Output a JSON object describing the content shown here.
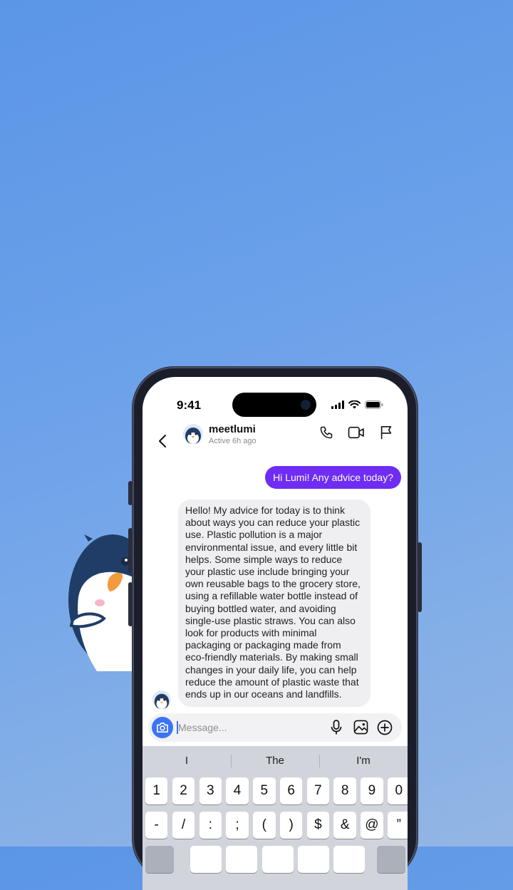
{
  "status_bar": {
    "time": "9:41"
  },
  "header": {
    "contact_name": "meetlumi",
    "active_status": "Active 6h ago",
    "icons": [
      "back-chevron-icon",
      "phone-icon",
      "video-icon",
      "flag-icon"
    ]
  },
  "messages": {
    "outgoing": "Hi Lumi! Any advice today?",
    "incoming": "Hello! My advice for today is to think about ways you can reduce your plastic use. Plastic pollution is a major environmental issue, and every little bit helps. Some simple ways to reduce your plastic use include bringing your own reusable bags to the grocery store, using a refillable water bottle instead of buying bottled water, and avoiding single-use plastic straws. You can also look for products with minimal packaging or packaging made from eco-friendly materials. By making small changes in your daily life, you can help reduce the amount of plastic waste that ends up in our oceans and landfills."
  },
  "composer": {
    "placeholder": "Message...",
    "icons": [
      "camera-icon",
      "microphone-icon",
      "image-icon",
      "plus-circle-icon"
    ]
  },
  "keyboard": {
    "suggestions": [
      "I",
      "The",
      "I'm"
    ],
    "number_row": [
      "1",
      "2",
      "3",
      "4",
      "5",
      "6",
      "7",
      "8",
      "9",
      "0"
    ],
    "symbol_row": [
      "-",
      "/",
      ":",
      ";",
      "(",
      ")",
      "$",
      "&",
      "@",
      "”"
    ]
  },
  "colors": {
    "background_start": "#5b95e6",
    "background_end": "#93b6e4",
    "outgoing_bubble": "#6f2cf3",
    "incoming_bubble": "#efeff1",
    "accent_blue": "#3b74f5"
  }
}
